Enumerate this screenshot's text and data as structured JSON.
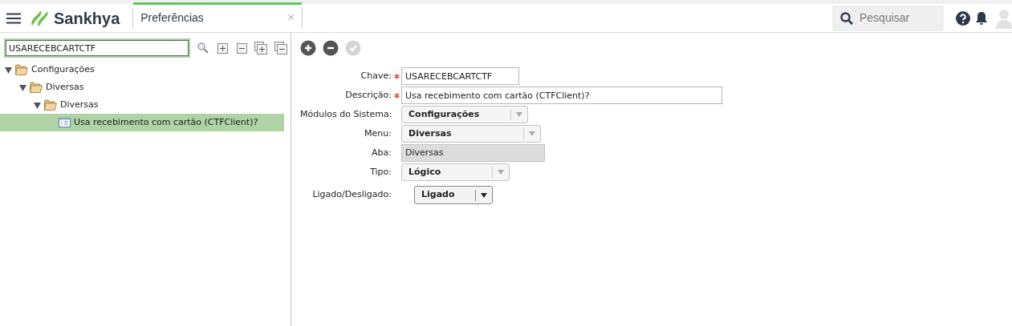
{
  "header": {
    "app_name": "Sankhya",
    "tab": {
      "label": "Preferências",
      "close": "×",
      "selected": true
    },
    "search": {
      "placeholder": "Pesquisar"
    }
  },
  "tree_panel": {
    "search": {
      "value": "USARECEBCARTCTF"
    },
    "tree": [
      {
        "label": "Configurações",
        "expanded": true,
        "selected": false,
        "children": [
          {
            "label": "Diversas",
            "expanded": true,
            "selected": false,
            "children": [
              {
                "label": "Diversas",
                "expanded": true,
                "selected": false,
                "children": [
                  {
                    "label": "Usa recebimento com cartão (CTFClient)?",
                    "selected": true
                  }
                ]
              }
            ]
          }
        ]
      }
    ]
  },
  "form": {
    "toolbar": [
      {
        "kind": "add",
        "disabled": false
      },
      {
        "kind": "remove",
        "disabled": false
      },
      {
        "kind": "confirm",
        "disabled": true
      }
    ],
    "fields": [
      {
        "kind": "text",
        "label": "Chave:",
        "required": true,
        "value": "USARECEBCARTCTF"
      },
      {
        "kind": "text",
        "label": "Descrição:",
        "required": true,
        "value": "Usa recebimento com cartão (CTFClient)?"
      },
      {
        "kind": "select",
        "label": "Módulos do Sistema:",
        "required": false,
        "value": "Configurações"
      },
      {
        "kind": "select",
        "label": "Menu:",
        "required": false,
        "value": "Diversas"
      },
      {
        "kind": "readonly",
        "label": "Aba:",
        "required": false,
        "value": "Diversas"
      },
      {
        "kind": "select",
        "label": "Tipo:",
        "required": false,
        "value": "Lógico"
      },
      {
        "kind": "switch-select",
        "label": "Ligado/Desligado:",
        "required": false,
        "value": "Ligado"
      }
    ]
  }
}
